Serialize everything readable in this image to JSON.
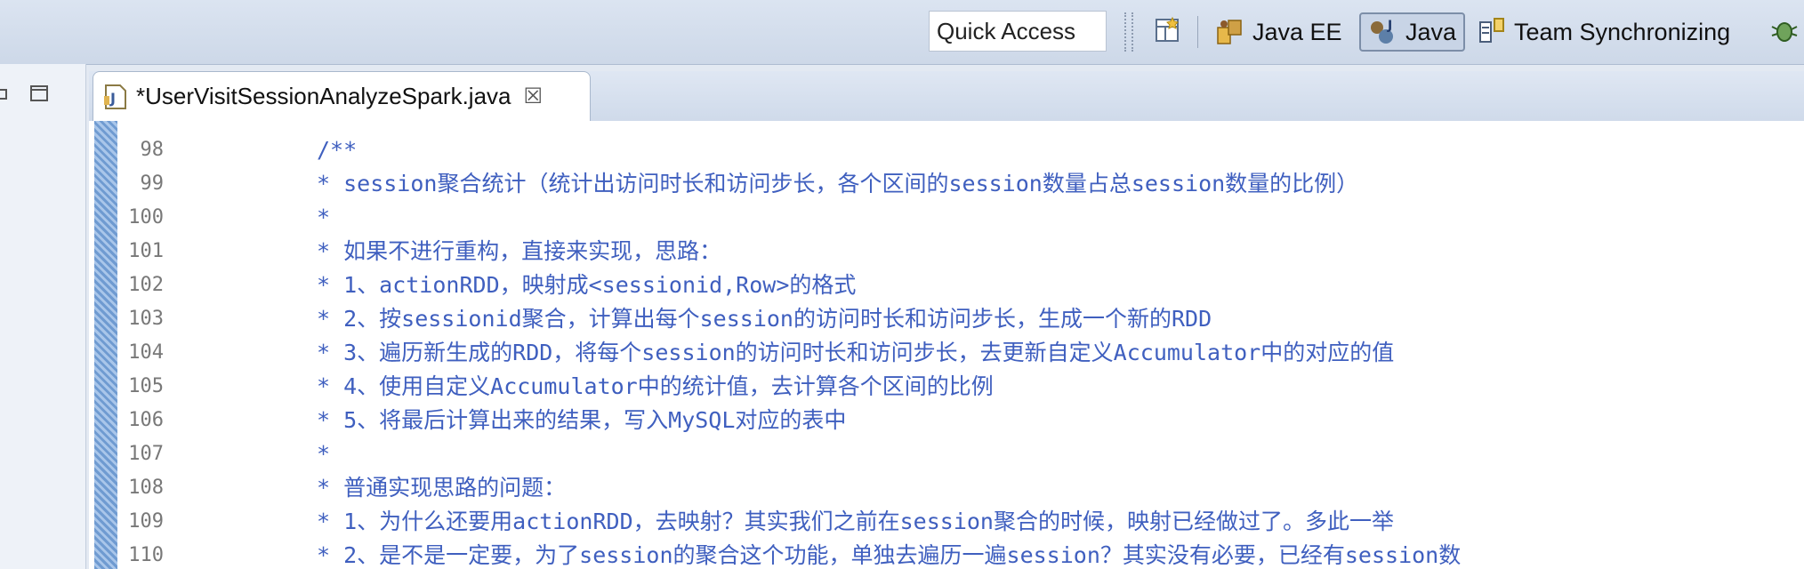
{
  "toolbar": {
    "quick_access_placeholder": "Quick Access",
    "perspectives": [
      {
        "label": "Java EE",
        "icon": "java-ee-perspective-icon",
        "active": false
      },
      {
        "label": "Java",
        "icon": "java-perspective-icon",
        "active": true
      },
      {
        "label": "Team Synchronizing",
        "icon": "team-sync-perspective-icon",
        "active": false
      }
    ]
  },
  "editor": {
    "tab_title": "*UserVisitSessionAnalyzeSpark.java",
    "lines": [
      {
        "num": "98",
        "text": "/**"
      },
      {
        "num": "99",
        "text": " * session聚合统计（统计出访问时长和访问步长，各个区间的session数量占总session数量的比例）"
      },
      {
        "num": "100",
        "text": " *"
      },
      {
        "num": "101",
        "text": " * 如果不进行重构，直接来实现，思路："
      },
      {
        "num": "102",
        "text": " * 1、actionRDD，映射成<sessionid,Row>的格式"
      },
      {
        "num": "103",
        "text": " * 2、按sessionid聚合，计算出每个session的访问时长和访问步长，生成一个新的RDD"
      },
      {
        "num": "104",
        "text": " * 3、遍历新生成的RDD，将每个session的访问时长和访问步长，去更新自定义Accumulator中的对应的值"
      },
      {
        "num": "105",
        "text": " * 4、使用自定义Accumulator中的统计值，去计算各个区间的比例"
      },
      {
        "num": "106",
        "text": " * 5、将最后计算出来的结果，写入MySQL对应的表中"
      },
      {
        "num": "107",
        "text": " *"
      },
      {
        "num": "108",
        "text": " * 普通实现思路的问题："
      },
      {
        "num": "109",
        "text": " * 1、为什么还要用actionRDD，去映射？其实我们之前在session聚合的时候，映射已经做过了。多此一举"
      },
      {
        "num": "110",
        "text": " * 2、是不是一定要，为了session的聚合这个功能，单独去遍历一遍session？其实没有必要，已经有session数"
      }
    ]
  }
}
